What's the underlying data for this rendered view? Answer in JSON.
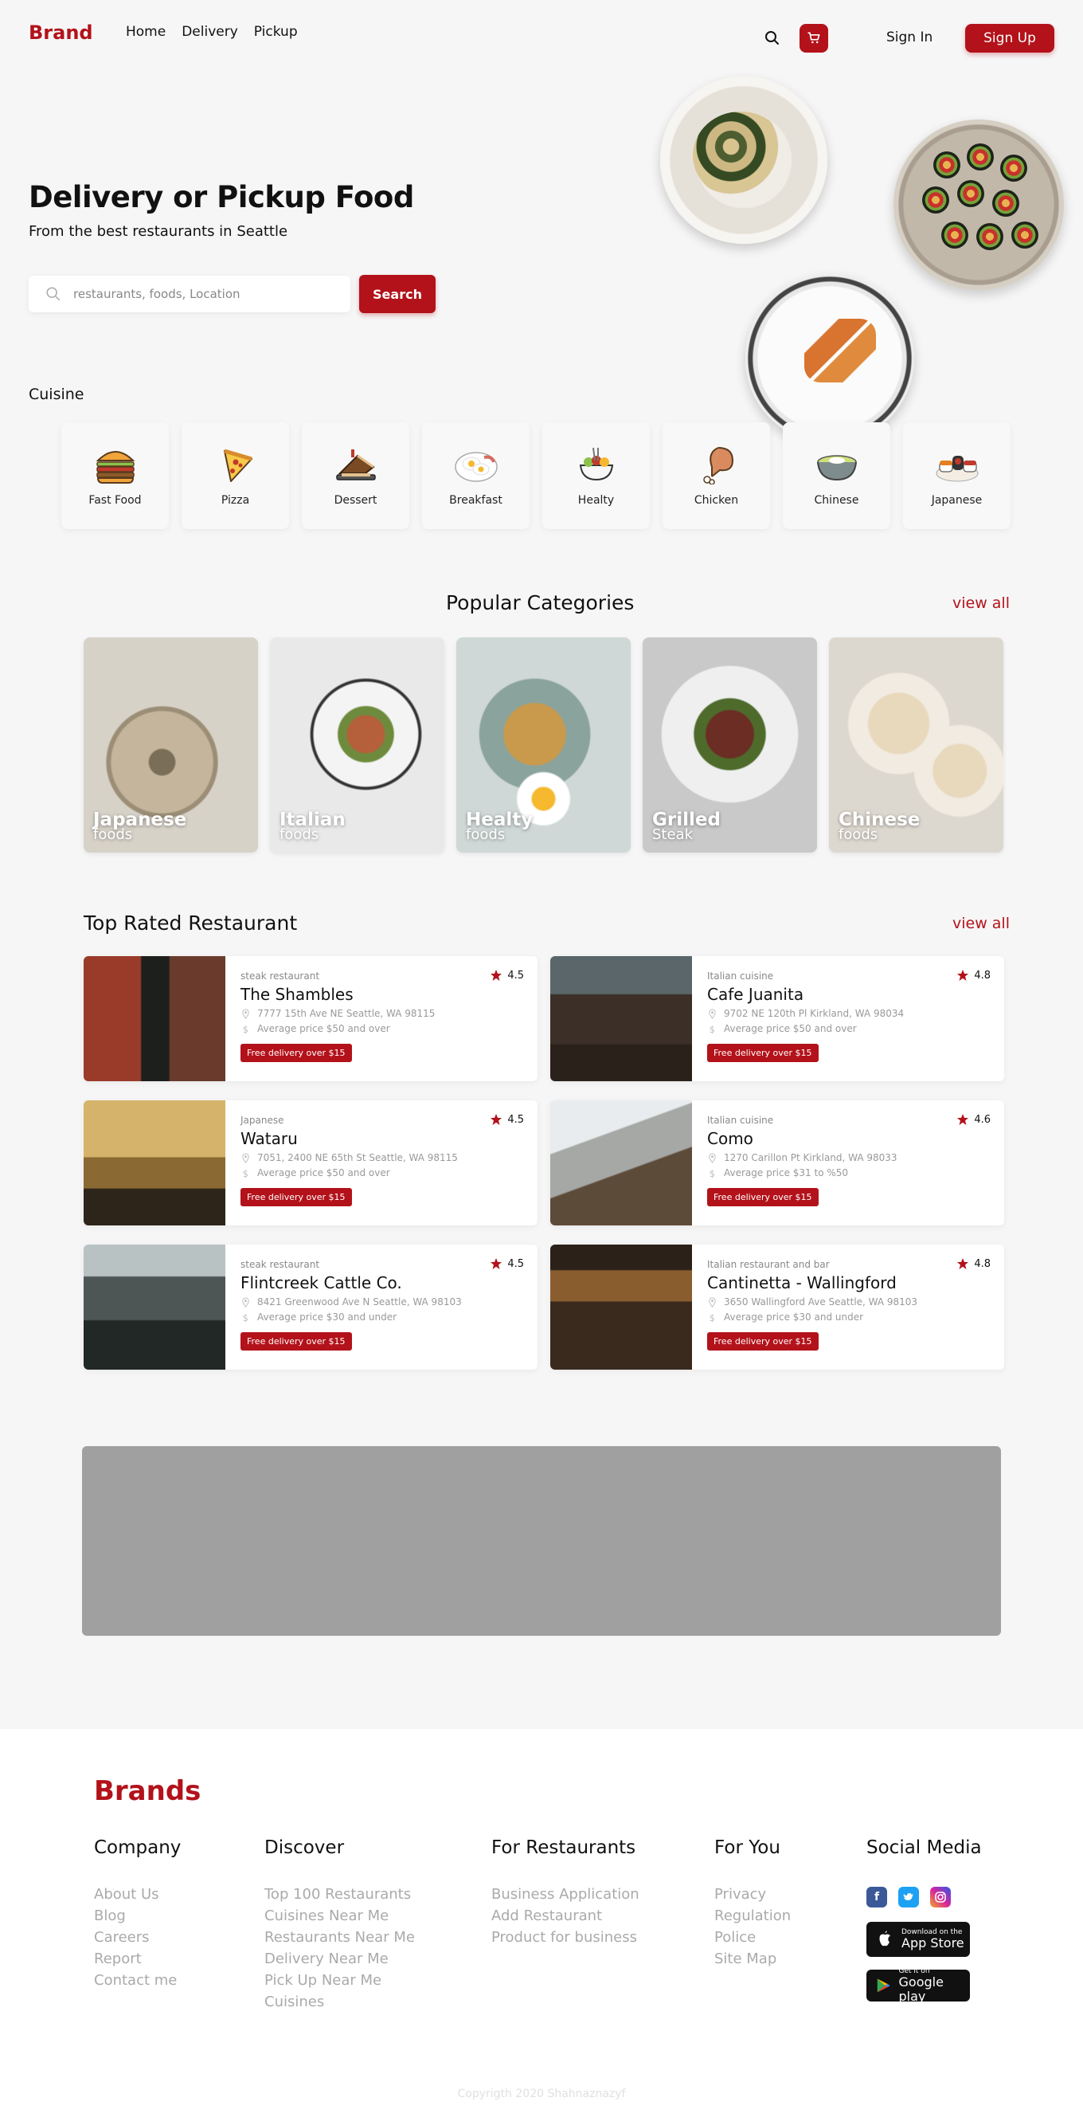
{
  "header": {
    "brand": "Brand",
    "nav": [
      "Home",
      "Delivery",
      "Pickup"
    ],
    "signin": "Sign In",
    "signup": "Sign Up"
  },
  "hero": {
    "title": "Delivery or Pickup Food",
    "subtitle": "From the best restaurants in Seattle",
    "search_placeholder": "restaurants, foods, Location",
    "search_button": "Search"
  },
  "cuisine": {
    "title": "Cuisine",
    "items": [
      {
        "label": "Fast Food",
        "icon": "burger-icon"
      },
      {
        "label": "Pizza",
        "icon": "pizza-icon"
      },
      {
        "label": "Dessert",
        "icon": "dessert-icon"
      },
      {
        "label": "Breakfast",
        "icon": "breakfast-icon"
      },
      {
        "label": "Healty",
        "icon": "salad-icon"
      },
      {
        "label": "Chicken",
        "icon": "chicken-leg-icon"
      },
      {
        "label": "Chinese",
        "icon": "bowl-icon"
      },
      {
        "label": "Japanese",
        "icon": "sushi-icon"
      }
    ]
  },
  "popular": {
    "title": "Popular Categories",
    "view_all": "view all",
    "items": [
      {
        "name": "Japanese",
        "sub": "foods"
      },
      {
        "name": "Italian",
        "sub": "foods"
      },
      {
        "name": "Healty",
        "sub": "foods"
      },
      {
        "name": "Grilled",
        "sub": "Steak"
      },
      {
        "name": "Chinese",
        "sub": "foods"
      }
    ]
  },
  "top_rated": {
    "title": "Top Rated Restaurant",
    "view_all": "view all",
    "items": [
      {
        "category": "steak restaurant",
        "name": "The Shambles",
        "address": "7777 15th Ave NE Seattle, WA 98115",
        "price": "Average price $50 and over",
        "badge": "Free delivery over $15",
        "rating": "4.5"
      },
      {
        "category": "Italian cuisine",
        "name": "Cafe Juanita",
        "address": "9702 NE 120th Pl Kirkland, WA 98034",
        "price": "Average price $50 and over",
        "badge": "Free delivery over $15",
        "rating": "4.8"
      },
      {
        "category": "Japanese",
        "name": "Wataru",
        "address": "7051, 2400 NE 65th St Seattle, WA 98115",
        "price": "Average price $50 and over",
        "badge": "Free delivery over $15",
        "rating": "4.5"
      },
      {
        "category": "Italian cuisine",
        "name": "Como",
        "address": "1270 Carillon Pt Kirkland, WA 98033",
        "price": "Average price $31 to %50",
        "badge": "Free delivery over $15",
        "rating": "4.6"
      },
      {
        "category": "steak restaurant",
        "name": "Flintcreek Cattle Co.",
        "address": "8421 Greenwood Ave N Seattle, WA 98103",
        "price": "Average price $30 and under",
        "badge": "Free delivery over $15",
        "rating": "4.5"
      },
      {
        "category": "Italian restaurant and bar",
        "name": "Cantinetta - Wallingford",
        "address": "3650 Wallingford Ave Seattle, WA 98103",
        "price": "Average price $30 and under",
        "badge": "Free delivery over $15",
        "rating": "4.8"
      }
    ]
  },
  "footer": {
    "brand": "Brands",
    "company": {
      "title": "Company",
      "links": [
        "About Us",
        "Blog",
        "Careers",
        "Report",
        "Contact me"
      ]
    },
    "discover": {
      "title": "Discover",
      "links": [
        "Top 100 Restaurants",
        "Cuisines Near Me",
        "Restaurants Near Me",
        "Delivery Near Me",
        "Pick Up Near Me",
        "Cuisines"
      ]
    },
    "restaurants": {
      "title": "For Restaurants",
      "links": [
        "Business Application",
        "Add Restaurant",
        "Product for business"
      ]
    },
    "you": {
      "title": "For You",
      "links": [
        "Privacy",
        "Regulation",
        "Police",
        "Site Map"
      ]
    },
    "social": {
      "title": "Social Media",
      "app_store_small": "Download on the",
      "app_store_large": "App Store",
      "google_small": "Get it on",
      "google_large": "Google play"
    },
    "copyright": "Copyrigth 2020 Shahnaznazyf"
  },
  "colors": {
    "accent": "#b3121a",
    "background": "#f6f6f6",
    "banner": "#a0a0a0"
  }
}
